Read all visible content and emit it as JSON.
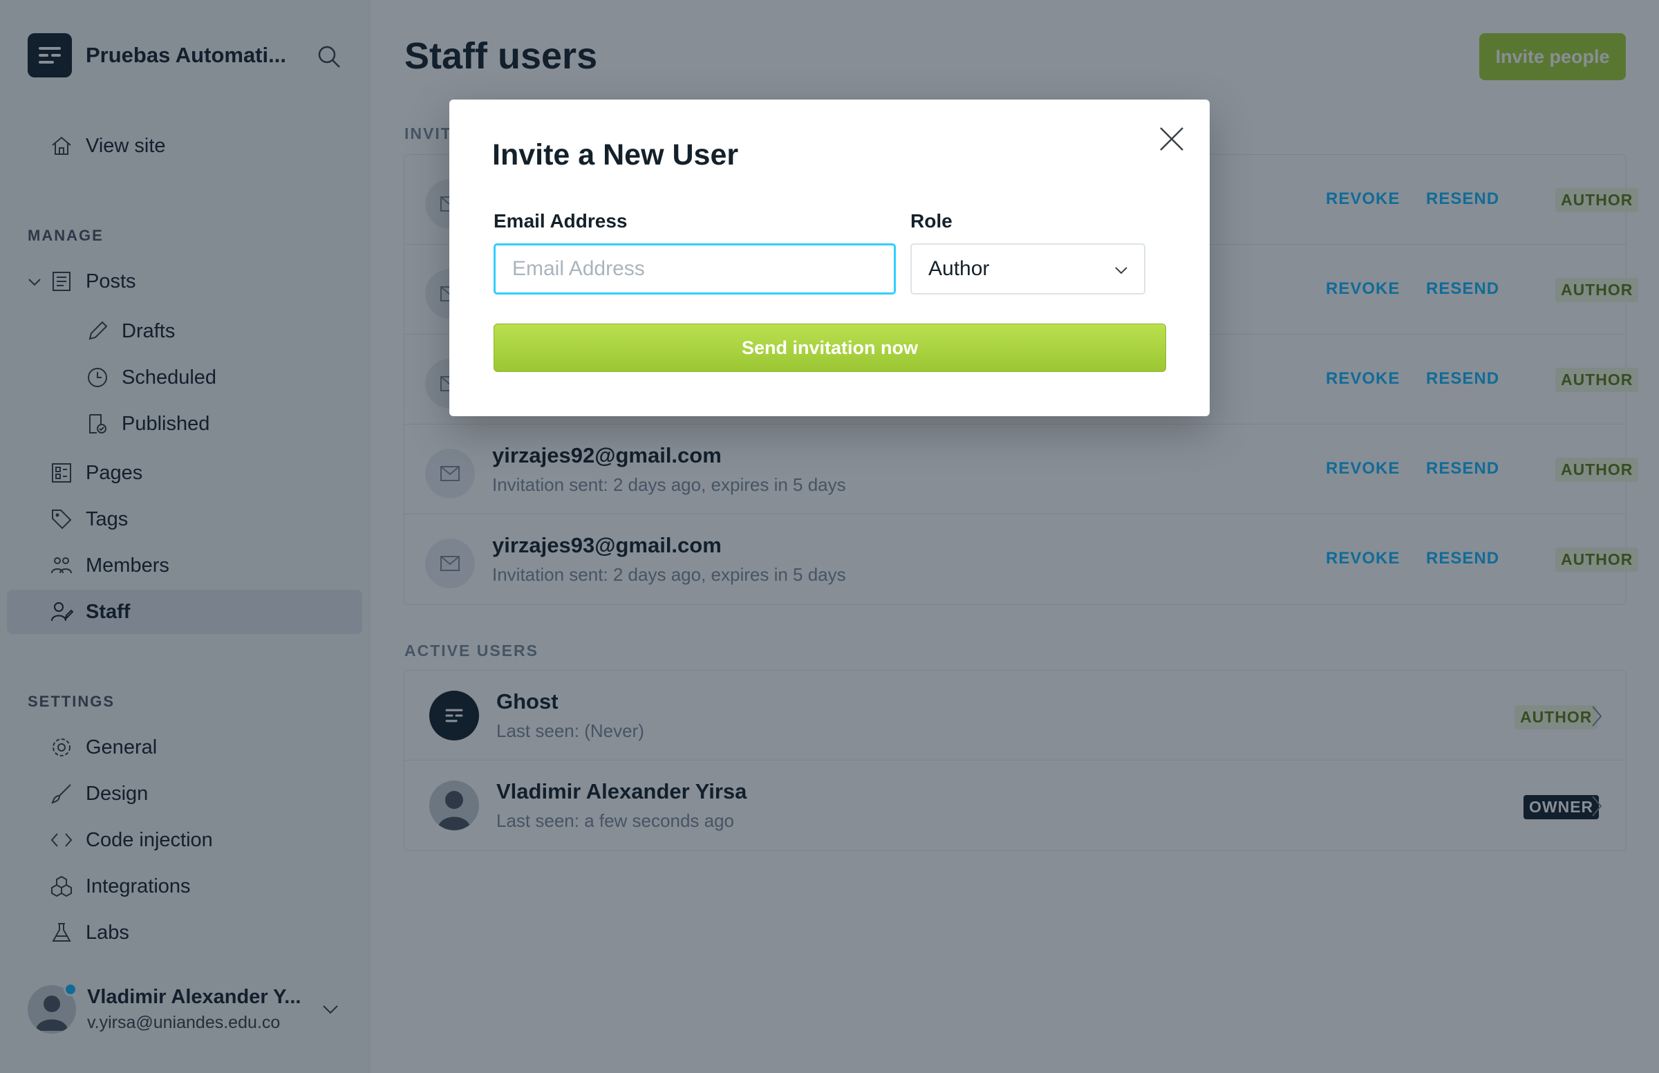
{
  "sidebar": {
    "site_name": "Pruebas Automati...",
    "view_site": "View site",
    "manage_heading": "MANAGE",
    "posts": "Posts",
    "drafts": "Drafts",
    "scheduled": "Scheduled",
    "published": "Published",
    "pages": "Pages",
    "tags": "Tags",
    "members": "Members",
    "staff": "Staff",
    "settings_heading": "SETTINGS",
    "general": "General",
    "design": "Design",
    "code_injection": "Code injection",
    "integrations": "Integrations",
    "labs": "Labs",
    "user_name": "Vladimir Alexander Y...",
    "user_email": "v.yirsa@uniandes.edu.co"
  },
  "main": {
    "title": "Staff users",
    "invite_button": "Invite people",
    "invited_label": "INVIT",
    "active_label": "ACTIVE USERS",
    "actions": {
      "revoke": "REVOKE",
      "resend": "RESEND"
    },
    "invited": [
      {
        "email": "",
        "sub": "",
        "role": "AUTHOR"
      },
      {
        "email": "",
        "sub": "",
        "role": "AUTHOR"
      },
      {
        "email": "",
        "sub": "",
        "role": "AUTHOR"
      },
      {
        "email": "yirzajes92@gmail.com",
        "sub": "Invitation sent: 2 days ago, expires in 5 days",
        "role": "AUTHOR"
      },
      {
        "email": "yirzajes93@gmail.com",
        "sub": "Invitation sent: 2 days ago, expires in 5 days",
        "role": "AUTHOR"
      }
    ],
    "active": [
      {
        "name": "Ghost",
        "sub": "Last seen: (Never)",
        "role": "AUTHOR"
      },
      {
        "name": "Vladimir Alexander Yirsa",
        "sub": "Last seen: a few seconds ago",
        "role": "OWNER"
      }
    ]
  },
  "modal": {
    "title": "Invite a New User",
    "email_label": "Email Address",
    "email_placeholder": "Email Address",
    "email_value": "",
    "role_label": "Role",
    "role_value": "Author",
    "send_button": "Send invitation now"
  },
  "colors": {
    "accent_green": "#a4d037",
    "link_blue": "#14b8ff",
    "dark": "#15212a"
  }
}
